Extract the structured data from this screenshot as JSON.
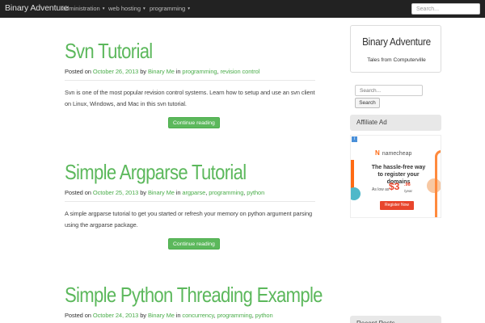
{
  "navbar": {
    "brand": "Binary Adventure",
    "items": [
      {
        "label": "administration",
        "caret": "▾"
      },
      {
        "label": "web hosting",
        "caret": "▾"
      },
      {
        "label": "programming",
        "caret": "▾"
      }
    ],
    "search_placeholder": "Search..."
  },
  "posts": [
    {
      "title": "Svn Tutorial",
      "posted_on_label": "Posted on",
      "date": "October 26, 2013",
      "by_label": "by",
      "author": "Binary Me",
      "in_label": "in",
      "categories": [
        "programming",
        "revision control"
      ],
      "excerpt": "Svn is one of the most popular revision control systems. Learn how to setup and use an svn client on Linux, Windows, and Mac in this svn tutorial.",
      "read_more": "Continue reading"
    },
    {
      "title": "Simple Argparse Tutorial",
      "posted_on_label": "Posted on",
      "date": "October 25, 2013",
      "by_label": "by",
      "author": "Binary Me",
      "in_label": "in",
      "categories": [
        "argparse",
        "programming",
        "python"
      ],
      "excerpt": "A simple argparse tutorial to get you started or refresh your memory on python argument parsing using the argparse package.",
      "read_more": "Continue reading"
    },
    {
      "title": "Simple Python Threading Example",
      "posted_on_label": "Posted on",
      "date": "October 24, 2013",
      "by_label": "by",
      "author": "Binary Me",
      "in_label": "in",
      "categories": [
        "concurrency",
        "programming",
        "python"
      ]
    }
  ],
  "sidebar": {
    "site_title": "Binary Adventure",
    "tagline": "Tales from Computerville",
    "search_placeholder": "Search...",
    "search_button": "Search",
    "affiliate_heading": "Affiliate Ad",
    "recent_heading": "Recent Posts"
  },
  "ad": {
    "close_glyph": "i",
    "brand": "namecheap",
    "brand_mark": "N",
    "headline": "The hassle-free way to register your domains",
    "as_low_as": "As low as",
    "price": "$3",
    "price_cents": ".98",
    "per": "/year",
    "cta": "Register Now"
  },
  "colors": {
    "accent": "#5cb85c",
    "navbar_bg": "#222222",
    "ad_orange": "#ff6a13",
    "ad_red": "#e8452c"
  }
}
